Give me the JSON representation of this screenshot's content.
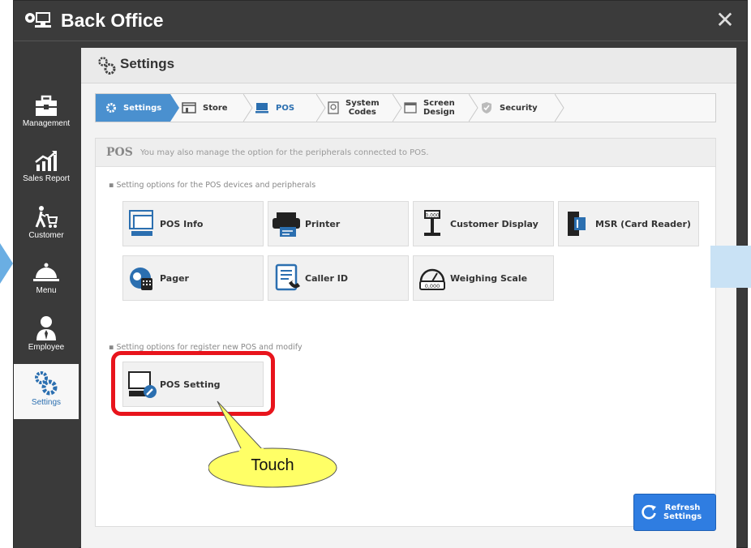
{
  "window": {
    "title": "Back Office",
    "close_glyph": "✕"
  },
  "sidebar": {
    "items": [
      {
        "label": "Management",
        "icon": "briefcase-icon"
      },
      {
        "label": "Sales Report",
        "icon": "chart-icon"
      },
      {
        "label": "Customer",
        "icon": "shopper-icon"
      },
      {
        "label": "Menu",
        "icon": "cloche-icon"
      },
      {
        "label": "Employee",
        "icon": "person-icon"
      },
      {
        "label": "Settings",
        "icon": "gears-icon"
      }
    ]
  },
  "panel": {
    "title": "Settings"
  },
  "tabs": [
    {
      "label": "Settings"
    },
    {
      "label": "Store"
    },
    {
      "label": "POS"
    },
    {
      "label_line1": "System",
      "label_line2": "Codes"
    },
    {
      "label_line1": "Screen",
      "label_line2": "Design"
    },
    {
      "label": "Security"
    }
  ],
  "pos": {
    "title": "POS",
    "subtitle": "You may also manage the option for the peripherals connected to POS.",
    "group1_label": "▪ Setting options for the POS devices and peripherals",
    "group2_label": "▪ Setting options for register new POS and modify",
    "tiles": [
      {
        "label": "POS Info"
      },
      {
        "label": "Printer"
      },
      {
        "label": "Customer Display"
      },
      {
        "label": "MSR (Card Reader)"
      },
      {
        "label": "Pager"
      },
      {
        "label": "Caller ID"
      },
      {
        "label": "Weighing Scale"
      }
    ],
    "pos_setting": {
      "label": "POS Setting"
    }
  },
  "callout": {
    "text": "Touch"
  },
  "refresh": {
    "line1": "Refresh",
    "line2": "Settings"
  },
  "colors": {
    "accent": "#4a90cf",
    "highlight": "#e8141c",
    "callout_fill": "#ffff66",
    "button_blue": "#2f7de1"
  }
}
